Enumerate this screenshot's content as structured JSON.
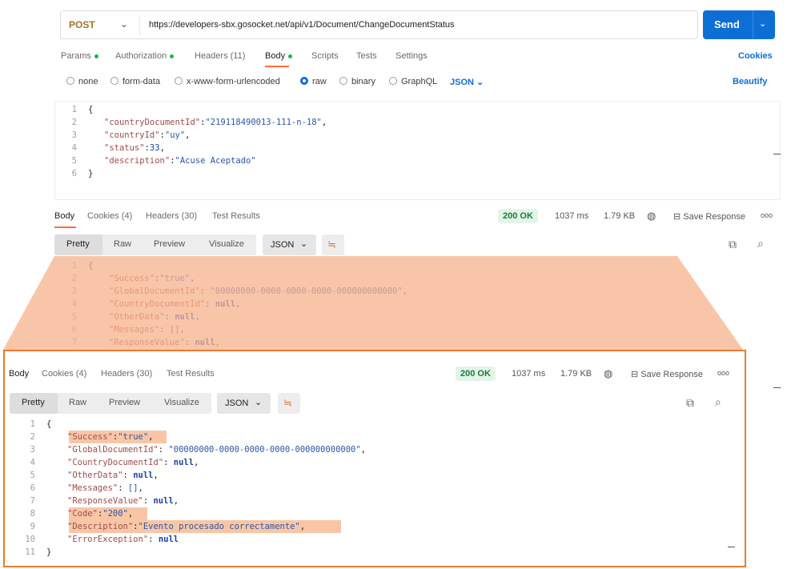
{
  "request": {
    "method": "POST",
    "url": "https://developers-sbx.gosocket.net/api/v1/Document/ChangeDocumentStatus",
    "send_label": "Send"
  },
  "request_tabs": {
    "params": "Params",
    "authorization": "Authorization",
    "headers": "Headers (11)",
    "body": "Body",
    "scripts": "Scripts",
    "tests": "Tests",
    "settings": "Settings",
    "cookies": "Cookies"
  },
  "body_types": {
    "none": "none",
    "form_data": "form-data",
    "urlencoded": "x-www-form-urlencoded",
    "raw": "raw",
    "binary": "binary",
    "graphql": "GraphQL",
    "format": "JSON",
    "beautify": "Beautify"
  },
  "request_body": {
    "line_numbers": [
      "1",
      "2",
      "3",
      "4",
      "5",
      "6"
    ],
    "open_brace": "{",
    "close_brace": "}",
    "fields": [
      {
        "key": "\"countryDocumentId\"",
        "sep": ":",
        "value": "\"219118490013-111-n-18\"",
        "tail": ","
      },
      {
        "key": "\"countryId\"",
        "sep": ":",
        "value": "\"uy\"",
        "tail": ","
      },
      {
        "key": "\"status\"",
        "sep": ":",
        "value": "33",
        "tail": ","
      },
      {
        "key": "\"description\"",
        "sep": ":",
        "value": "\"Acuse Aceptado\"",
        "tail": ""
      }
    ]
  },
  "response": {
    "tabs": {
      "body": "Body",
      "cookies": "Cookies (4)",
      "headers": "Headers (30)",
      "test_results": "Test Results"
    },
    "status": "200 OK",
    "time": "1037 ms",
    "size": "1.79 KB",
    "save": "Save Response",
    "more": "ooo",
    "views": {
      "pretty": "Pretty",
      "raw": "Raw",
      "preview": "Preview",
      "visualize": "Visualize"
    },
    "format": "JSON",
    "line_numbers_short": [
      "1",
      "2",
      "3",
      "4",
      "5",
      "6",
      "7"
    ],
    "line_numbers": [
      "1",
      "2",
      "3",
      "4",
      "5",
      "6",
      "7",
      "8",
      "9",
      "10",
      "11"
    ],
    "open_brace": "{",
    "close_brace": "}",
    "fields": [
      {
        "key": "\"Success\"",
        "sep": ":",
        "value": "\"true\"",
        "tail": ","
      },
      {
        "key": "\"GlobalDocumentId\"",
        "sep": ": ",
        "value": "\"00000000-0000-0000-0000-000000000000\"",
        "tail": ","
      },
      {
        "key": "\"CountryDocumentId\"",
        "sep": ": ",
        "value": "null",
        "tail": ","
      },
      {
        "key": "\"OtherData\"",
        "sep": ": ",
        "value": "null",
        "tail": ","
      },
      {
        "key": "\"Messages\"",
        "sep": ": ",
        "value": "[]",
        "tail": ","
      },
      {
        "key": "\"ResponseValue\"",
        "sep": ": ",
        "value": "null",
        "tail": ","
      },
      {
        "key": "\"Code\"",
        "sep": ":",
        "value": "\"200\"",
        "tail": ","
      },
      {
        "key": "\"Description\"",
        "sep": ":",
        "value": "\"Evento procesado correctamente\"",
        "tail": ","
      },
      {
        "key": "\"ErrorException\"",
        "sep": ": ",
        "value": "null",
        "tail": ""
      }
    ]
  },
  "colors": {
    "accent": "#0d6fd6",
    "highlight": "#f8c6a6",
    "callout_border": "#e87b2e",
    "status_green": "#1b7a3e"
  }
}
